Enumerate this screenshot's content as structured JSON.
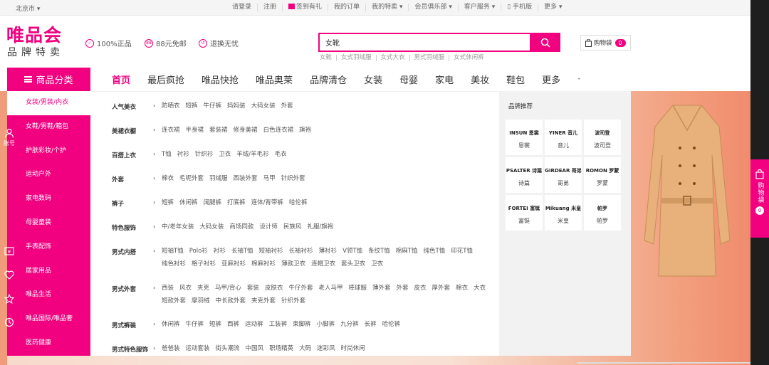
{
  "topbar": {
    "city": "北京市",
    "links": [
      "请登录",
      "注册",
      "签到有礼",
      "我的订单",
      "我的特卖",
      "会员俱乐部",
      "客户服务",
      "手机版",
      "更多"
    ]
  },
  "logo": {
    "main": "唯品会",
    "sub": "品牌特卖"
  },
  "promises": [
    "100%正品",
    "88元免邮",
    "退换无忧"
  ],
  "search": {
    "value": "女靴",
    "hot": [
      "女靴",
      "女式羽绒服",
      "女式大衣",
      "男式羽绒服",
      "女式休闲裤"
    ]
  },
  "cart": {
    "label": "购物袋",
    "count": "0"
  },
  "nav": {
    "category_label": "商品分类",
    "items": [
      "首页",
      "最后疯抢",
      "唯品快抢",
      "唯品奥莱",
      "品牌清仓",
      "女装",
      "母婴",
      "家电",
      "美妆",
      "鞋包",
      "更多"
    ]
  },
  "categories": [
    "女装/男装/内衣",
    "女鞋/男鞋/箱包",
    "护肤彩妆/个护",
    "运动户外",
    "家电数码",
    "母婴童装",
    "手表配饰",
    "居家用品",
    "唯品生活",
    "唯品国际/唯品奢",
    "医药健康"
  ],
  "flyout": [
    {
      "label": "人气美衣",
      "items": [
        "防晒衣",
        "短裤",
        "牛仔裤",
        "妈妈装",
        "大码女装",
        "外套"
      ]
    },
    {
      "label": "美裙衣橱",
      "items": [
        "连衣裙",
        "半身裙",
        "套装裙",
        "修身美裙",
        "白色连衣裙",
        "旗袍"
      ]
    },
    {
      "label": "百搭上衣",
      "items": [
        "T恤",
        "衬衫",
        "针织衫",
        "卫衣",
        "羊绒/羊毛衫",
        "毛衣"
      ]
    },
    {
      "label": "外套",
      "items": [
        "棉衣",
        "毛呢外套",
        "羽绒服",
        "西装外套",
        "马甲",
        "针织外套"
      ]
    },
    {
      "label": "裤子",
      "items": [
        "短裤",
        "休闲裤",
        "阔腿裤",
        "打底裤",
        "连体/背带裤",
        "哈伦裤"
      ]
    },
    {
      "label": "特色服饰",
      "items": [
        "中/老年女装",
        "大码女装",
        "商场同款",
        "设计师",
        "民族风",
        "礼服/旗袍"
      ]
    },
    {
      "label": "男式内搭",
      "items": [
        "短袖T恤",
        "Polo衫",
        "衬衫",
        "长袖T恤",
        "短袖衬衫",
        "长袖衬衫",
        "薄衬衫",
        "V领T恤",
        "条纹T恤",
        "棉麻T恤",
        "纯色T恤",
        "印花T恤",
        "纯色衬衫",
        "格子衬衫",
        "亚麻衬衫",
        "棉麻衬衫",
        "薄款卫衣",
        "连帽卫衣",
        "套头卫衣",
        "卫衣"
      ]
    },
    {
      "label": "男式外套",
      "items": [
        "西装",
        "风衣",
        "夹克",
        "马甲/背心",
        "套装",
        "皮肤衣",
        "牛仔外套",
        "老人马甲",
        "棒球服",
        "薄外套",
        "外套",
        "皮衣",
        "厚外套",
        "棉衣",
        "大衣",
        "短款外套",
        "摩羽绒",
        "中长款外套",
        "夹克外套",
        "针织外套"
      ]
    },
    {
      "label": "男式裤装",
      "items": [
        "休闲裤",
        "牛仔裤",
        "短裤",
        "西裤",
        "运动裤",
        "工装裤",
        "束脚裤",
        "小脚裤",
        "九分裤",
        "长裤",
        "哈伦裤"
      ]
    },
    {
      "label": "男式特色服饰",
      "items": [
        "爸爸装",
        "运动套装",
        "街头潮流",
        "中国风",
        "职场精英",
        "大码",
        "迷彩风",
        "时尚休闲"
      ]
    }
  ],
  "brands": {
    "title": "品牌推荐",
    "items": [
      {
        "logo": "INSUN 恩裳",
        "name": "恩裳"
      },
      {
        "logo": "YINER 音儿",
        "name": "音儿"
      },
      {
        "logo": "波司登",
        "name": "波司登"
      },
      {
        "logo": "PSALTER 诗篇",
        "name": "诗篇"
      },
      {
        "logo": "GIRDEAR 哥弟",
        "name": "哥弟"
      },
      {
        "logo": "ROMON 罗蒙",
        "name": "罗蒙"
      },
      {
        "logo": "FORTEI 富铤",
        "name": "富铤"
      },
      {
        "logo": "Mikuang 米皇",
        "name": "米皇"
      },
      {
        "logo": "帕罗",
        "name": "帕罗"
      }
    ]
  },
  "rightbar": {
    "account": "账号",
    "cart": "购物袋",
    "cart_count": "0"
  },
  "colors": {
    "accent": "#f10180",
    "sidebar_dark": "#1e1e1e"
  }
}
